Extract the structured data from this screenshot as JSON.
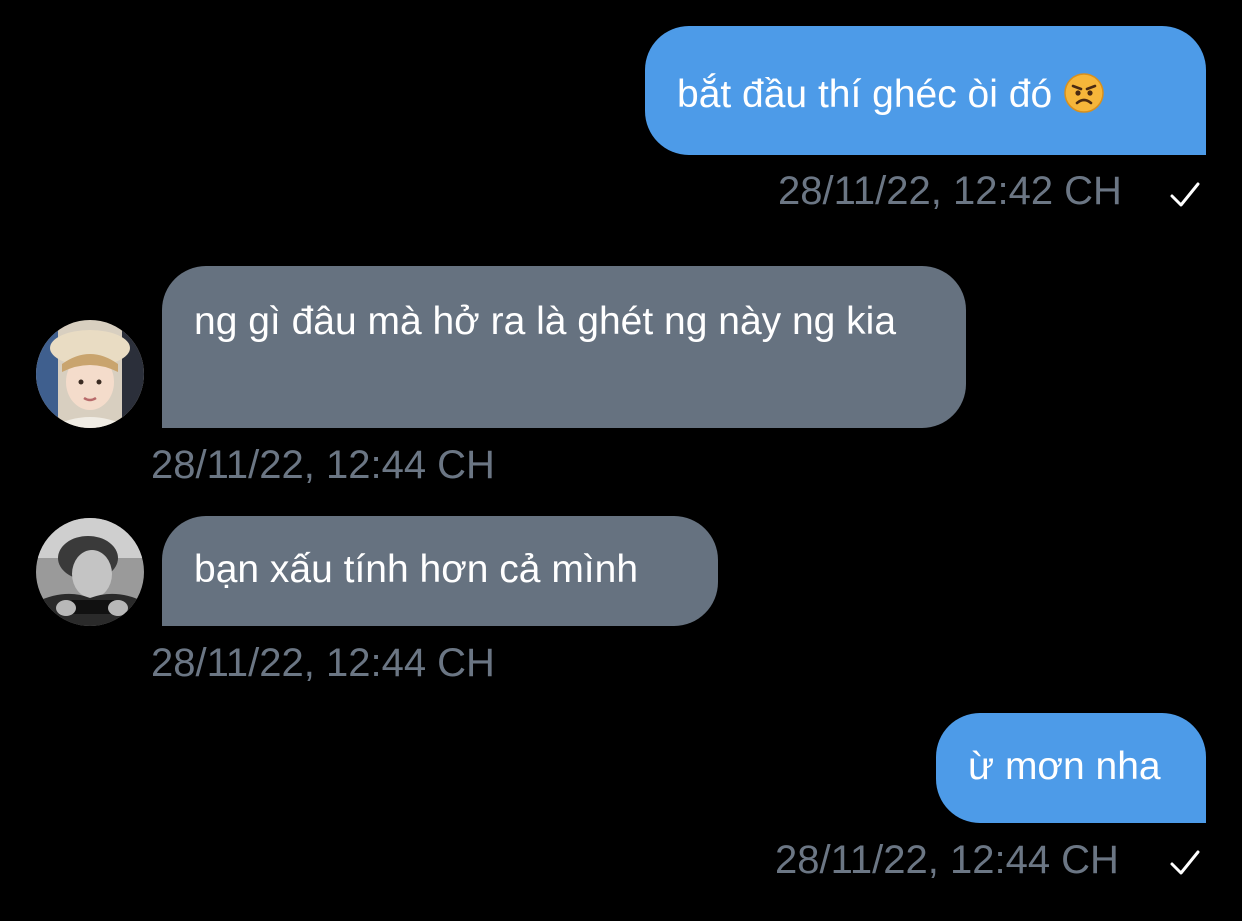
{
  "conversation": {
    "messages": [
      {
        "direction": "sent",
        "text": "bắt đầu thí ghéc òi đó",
        "emoji": "angry-face-emoji",
        "timestamp": "28/11/22, 12:42 CH",
        "status_icon": "check-icon"
      },
      {
        "direction": "received",
        "text": "ng gì đâu mà hở ra là ghét ng này ng kia",
        "timestamp": "28/11/22, 12:44 CH",
        "avatar": "avatar-photo"
      },
      {
        "direction": "received",
        "text": "bạn xấu tính hơn cả mình",
        "timestamp": "28/11/22, 12:44 CH",
        "avatar": "avatar-photo-grayscale"
      },
      {
        "direction": "sent",
        "text": "ừ mơn nha",
        "timestamp": "28/11/22, 12:44 CH",
        "status_icon": "check-icon"
      }
    ]
  },
  "colors": {
    "background": "#000000",
    "sent_bubble": "#4d9be8",
    "received_bubble": "#667280",
    "timestamp_text": "#6b7684",
    "message_text": "#ffffff"
  }
}
